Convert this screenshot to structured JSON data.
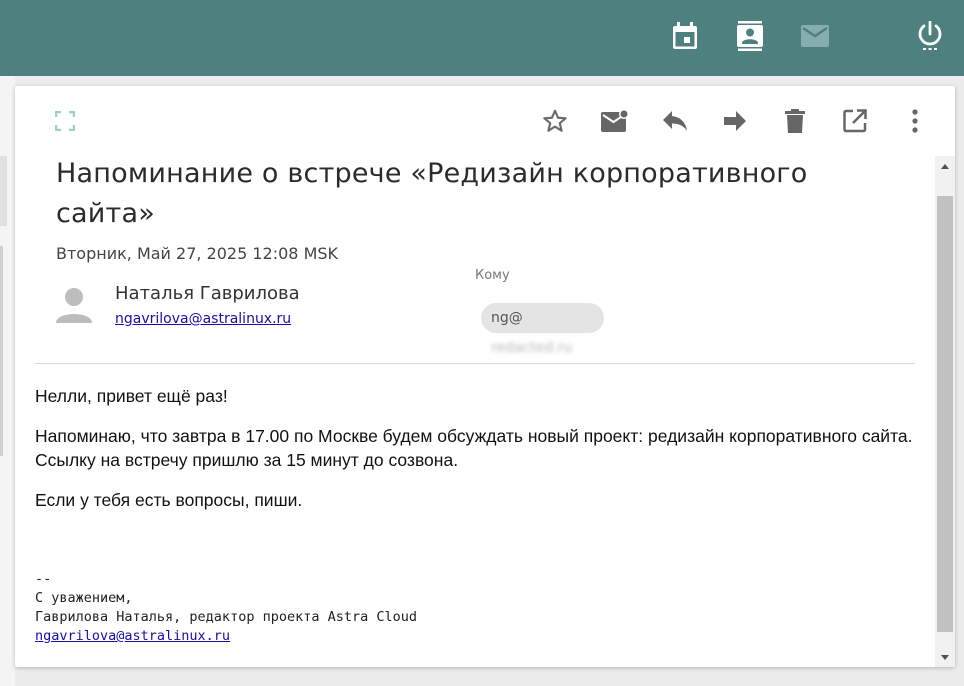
{
  "topbar": {
    "color": "#4f8080",
    "icons": [
      "calendar-icon",
      "contacts-icon",
      "mail-icon",
      "power-icon"
    ]
  },
  "toolbar": {
    "icons": [
      "fullscreen-icon",
      "star-icon",
      "mark-unread-icon",
      "reply-icon",
      "forward-icon",
      "delete-icon",
      "open-external-icon",
      "more-vert-icon"
    ]
  },
  "message": {
    "subject": "Напоминание о встрече «Редизайн корпоративного сайта»",
    "date": "Вторник, Май 27, 2025 12:08 MSK",
    "sender": {
      "name": "Наталья Гаврилова",
      "email": "ngavrilova@astralinux.ru"
    },
    "to": {
      "label": "Кому",
      "prefix": "ng@",
      "hidden": "redacted.ru"
    },
    "body": {
      "greeting": "Нелли, привет ещё раз!",
      "paragraph": "Напоминаю, что завтра в 17.00 по Москве будем обсуждать новый проект: редизайн корпоративного сайта. Ссылку на встречу пришлю за 15 минут до созвона.",
      "closing": "Если у тебя есть вопросы, пиши."
    },
    "signature": {
      "separator": "--",
      "regards": "С уважением,",
      "role": "Гаврилова Наталья, редактор проекта Astra Cloud",
      "email": "ngavrilova@astralinux.ru"
    }
  }
}
